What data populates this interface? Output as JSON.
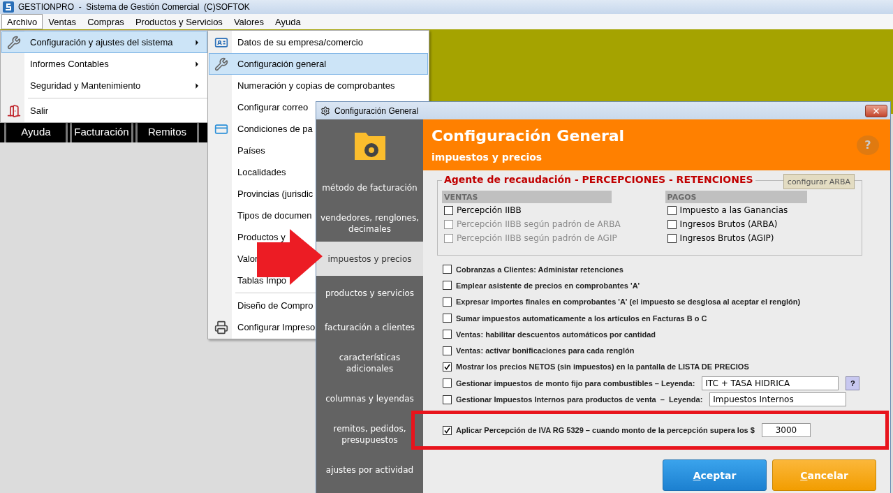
{
  "app": {
    "title": "GESTIONPRO  -  Sistema de Gestión Comercial  (C)SOFTOK"
  },
  "menubar": [
    {
      "label": "Archivo",
      "selected": true
    },
    {
      "label": "Ventas",
      "selected": false
    },
    {
      "label": "Compras",
      "selected": false
    },
    {
      "label": "Productos y Servicios",
      "selected": false
    },
    {
      "label": "Valores",
      "selected": false
    },
    {
      "label": "Ayuda",
      "selected": false
    }
  ],
  "toolbar": [
    {
      "label": "Ayuda"
    },
    {
      "label": "Facturación"
    },
    {
      "label": "Remitos"
    }
  ],
  "file_menu": [
    {
      "kind": "item",
      "label": "Configuración y ajustes del sistema",
      "has_submenu": true,
      "selected": true
    },
    {
      "kind": "item",
      "label": "Informes Contables",
      "has_submenu": true,
      "selected": false
    },
    {
      "kind": "item",
      "label": "Seguridad y Mantenimiento",
      "has_submenu": true,
      "selected": false
    },
    {
      "kind": "separator"
    },
    {
      "kind": "item",
      "label": "Salir",
      "has_submenu": false,
      "selected": false
    }
  ],
  "submenu": [
    {
      "kind": "item",
      "label": "Datos de su empresa/comercio",
      "selected": false
    },
    {
      "kind": "item",
      "label": "Configuración general",
      "selected": true
    },
    {
      "kind": "item",
      "label": "Numeración y copias de comprobantes",
      "selected": false
    },
    {
      "kind": "item",
      "label": "Configurar correo",
      "selected": false
    },
    {
      "kind": "item",
      "label": "Condiciones de pa",
      "selected": false
    },
    {
      "kind": "item",
      "label": "Países",
      "selected": false
    },
    {
      "kind": "item",
      "label": "Localidades",
      "selected": false
    },
    {
      "kind": "item",
      "label": "Provincias (jurisdic",
      "selected": false
    },
    {
      "kind": "item",
      "label": "Tipos de documen",
      "selected": false
    },
    {
      "kind": "item",
      "label": "Productos y",
      "selected": false
    },
    {
      "kind": "item",
      "label": "Valor",
      "selected": false
    },
    {
      "kind": "item",
      "label": "Tablas Impo",
      "selected": false
    },
    {
      "kind": "separator"
    },
    {
      "kind": "item",
      "label": "Diseño de Compro",
      "selected": false
    },
    {
      "kind": "item",
      "label": "Configurar Impreso",
      "selected": false
    }
  ],
  "dialog": {
    "title": "Configuración General",
    "header": {
      "title": "Configuración General",
      "subtitle": "impuestos y precios",
      "help": "?"
    },
    "sidebar": [
      {
        "label": "método de facturación",
        "selected": false
      },
      {
        "label": "vendedores, renglones, decimales",
        "selected": false
      },
      {
        "label": "impuestos y precios",
        "selected": true
      },
      {
        "label": "productos y servicios",
        "selected": false
      },
      {
        "label": "facturación a clientes",
        "selected": false
      },
      {
        "label": "características adicionales",
        "selected": false
      },
      {
        "label": "columnas y leyendas",
        "selected": false
      },
      {
        "label": "remitos, pedidos, presupuestos",
        "selected": false
      },
      {
        "label": "ajustes por actividad",
        "selected": false
      }
    ],
    "group": {
      "title": "Agente de recaudación - PERCEPCIONES - RETENCIONES",
      "button": "configurar ARBA",
      "columns": [
        {
          "heading": "VENTAS",
          "options": [
            {
              "label": "Percepción IIBB",
              "checked": false,
              "disabled": false
            },
            {
              "label": "Percepción IIBB según padrón de ARBA",
              "checked": false,
              "disabled": true
            },
            {
              "label": "Percepción IIBB según padrón de AGIP",
              "checked": false,
              "disabled": true
            }
          ]
        },
        {
          "heading": "PAGOS",
          "options": [
            {
              "label": "Impuesto a las Ganancias",
              "checked": false,
              "disabled": false
            },
            {
              "label": "Ingresos Brutos (ARBA)",
              "checked": false,
              "disabled": false
            },
            {
              "label": "Ingresos Brutos (AGIP)",
              "checked": false,
              "disabled": false
            }
          ]
        }
      ]
    },
    "options": [
      {
        "kind": "check",
        "label": "Cobranzas a Clientes: Administar retenciones",
        "checked": false
      },
      {
        "kind": "check",
        "label": "Emplear asistente de precios en comprobantes 'A'",
        "checked": false
      },
      {
        "kind": "check",
        "label": "Expresar importes finales en comprobantes 'A' (el impuesto se desglosa al aceptar el renglón)",
        "checked": false
      },
      {
        "kind": "check",
        "label": "Sumar impuestos automaticamente a los artículos en Facturas B o C",
        "checked": false
      },
      {
        "kind": "check",
        "label": "Ventas: habilitar descuentos automáticos por cantidad",
        "checked": false
      },
      {
        "kind": "check",
        "label": "Ventas: activar bonificaciones para cada renglón",
        "checked": false
      },
      {
        "kind": "check",
        "label": "Mostrar los precios NETOS (sin impuestos) en la pantalla de LISTA DE PRECIOS",
        "checked": true
      },
      {
        "kind": "field",
        "label": "Gestionar impuestos de monto fijo para combustibles – Leyenda:",
        "checked": false,
        "value": "ITC + TASA HIDRICA",
        "help": "?"
      },
      {
        "kind": "field",
        "label": "Gestionar Impuestos Internos para productos de venta  –  Leyenda:",
        "checked": false,
        "value": "Impuestos Internos"
      }
    ],
    "highlighted": {
      "label": "Aplicar Percepción de IVA RG 5329 – cuando monto de la percepción supera los $",
      "checked": true,
      "value": "3000"
    },
    "buttons": [
      {
        "label": "Aceptar",
        "kind": "primary"
      },
      {
        "label": "Cancelar",
        "kind": "cancel"
      }
    ]
  }
}
